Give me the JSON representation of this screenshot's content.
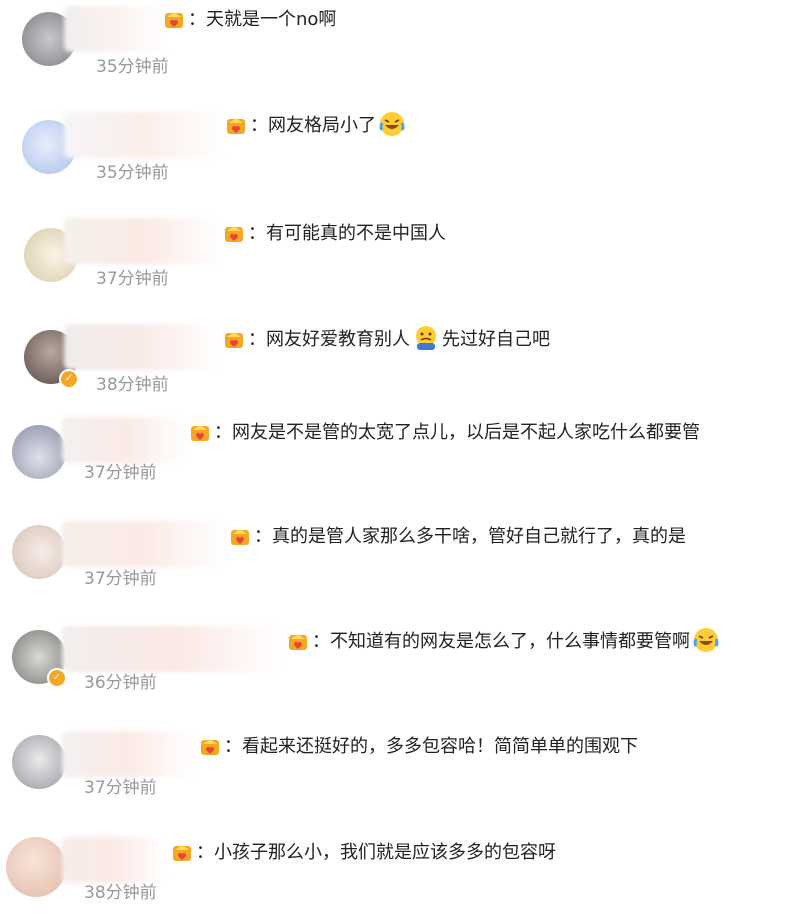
{
  "comments": [
    {
      "text": "：天就是一个no啊",
      "time": "35分钟前"
    },
    {
      "text": "：网友格局小了",
      "time": "35分钟前",
      "emoji": "laughing-crying-emoji"
    },
    {
      "text": "：有可能真的不是中国人",
      "time": "37分钟前"
    },
    {
      "text": "：网友好爱教育别人",
      "text2": "先过好自己吧",
      "time": "38分钟前",
      "emoji": "sad-emoji",
      "verified": true
    },
    {
      "text": "：网友是不是管的太宽了点儿，以后是不起人家吃什么都要管",
      "time": "37分钟前"
    },
    {
      "text": "：真的是管人家那么多干啥，管好自己就行了，真的是",
      "time": "37分钟前"
    },
    {
      "text": "：不知道有的网友是怎么了，什么事情都要管啊",
      "time": "36分钟前",
      "emoji": "laughing-crying-emoji",
      "verified": true
    },
    {
      "text": "：看起来还挺好的，多多包容哈！简简单单的围观下",
      "time": "37分钟前"
    },
    {
      "text": "：小孩子那么小，我们就是应该多多的包容呀",
      "time": "38分钟前"
    }
  ],
  "badge_glyph": "✓",
  "colors": {
    "text": "#222222",
    "time": "#999999",
    "badge": "#f5a623",
    "crown": "#f5a623"
  }
}
